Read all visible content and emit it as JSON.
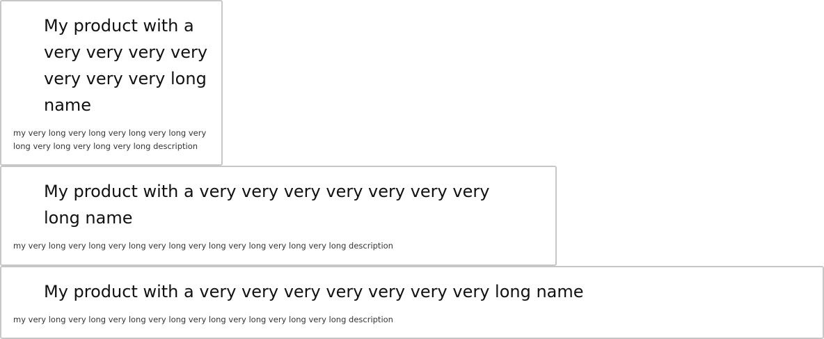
{
  "cards": [
    {
      "title": "My product with a very very very very very very very long name",
      "description": "my very long very long very long very long very long very long very long very long description"
    },
    {
      "title": "My product with a very very very very very very very long name",
      "description": "my very long very long very long very long very long very long very long very long description"
    },
    {
      "title": "My product with a very very very very very very very long name",
      "description": "my very long very long very long very long very long very long very long very long description"
    }
  ]
}
